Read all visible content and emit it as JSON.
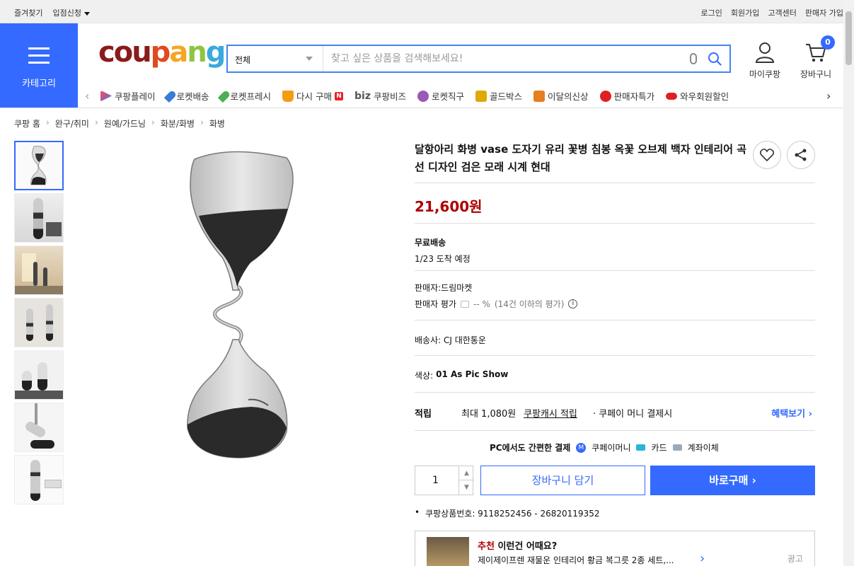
{
  "topbar": {
    "favorites": "즐겨찾기",
    "vendor_apply": "입점신청",
    "login": "로그인",
    "signup": "회원가입",
    "customer_center": "고객센터",
    "seller_signup": "판매자 가입"
  },
  "category": {
    "label": "카테고리"
  },
  "logo": {
    "part1": "cou",
    "part2": "p",
    "part3": "a",
    "part4": "n",
    "part5": "g"
  },
  "search": {
    "category_value": "전체",
    "placeholder": "찾고 싶은 상품을 검색해보세요!"
  },
  "header": {
    "my_coupang": "마이쿠팡",
    "cart": "장바구니",
    "cart_count": "0"
  },
  "nav": {
    "items": [
      {
        "label": "쿠팡플레이",
        "icon": "play-icon",
        "color": "#4a6cf7"
      },
      {
        "label": "로켓배송",
        "icon": "rocket-icon",
        "color": "#3a7bd5"
      },
      {
        "label": "로켓프레시",
        "icon": "rocket-fresh-icon",
        "color": "#4caf50"
      },
      {
        "label": "다시 구매",
        "icon": "basket-icon",
        "color": "#f39c12"
      },
      {
        "label": "쿠팡비즈",
        "icon": "biz-icon",
        "color": "#555555"
      },
      {
        "label": "로켓직구",
        "icon": "rocket-global-icon",
        "color": "#9b59b6"
      },
      {
        "label": "골드박스",
        "icon": "gift-icon",
        "color": "#e0a800"
      },
      {
        "label": "이달의신상",
        "icon": "new-bag-icon",
        "color": "#e67e22"
      },
      {
        "label": "판매자특가",
        "icon": "percent-icon",
        "color": "#e02020"
      },
      {
        "label": "와우회원할인",
        "icon": "wow-icon",
        "color": "#e02020"
      }
    ],
    "again_badge": "N",
    "biz_prefix": "biz"
  },
  "breadcrumb": [
    "쿠팡 홈",
    "완구/취미",
    "원예/가드닝",
    "화분/화병",
    "화병"
  ],
  "product": {
    "title": "달항아리 화병 vase 도자기 유리 꽃병 침봉 옥꽃 오브제 백자 인테리어 곡선 디자인 검은 모래 시계 현대",
    "price": "21,600원",
    "shipping_label": "무료배송",
    "arrival": "1/23 도착 예정",
    "seller": "판매자:드림마켓",
    "seller_rating_label": "판매자 평가",
    "seller_rating_value": "-- %",
    "seller_rating_note": "(14건 이하의 평가)",
    "carrier": "배송사:  CJ 대한통운",
    "color_label": "색상:",
    "color_value": "01 As Pic Show",
    "reward_label": "적립",
    "reward_text": "최대 1,080원",
    "reward_link": "쿠팡캐시 적립",
    "reward_suffix": "· 쿠페이 머니 결제시",
    "benefit_link": "혜택보기",
    "pay_title": "PC에서도 간편한 결제",
    "pay_methods": [
      "쿠페이머니",
      "카드",
      "계좌이체"
    ],
    "quantity": "1",
    "add_to_cart": "장바구니 담기",
    "buy_now": "바로구매",
    "product_number": "쿠팡상품번호: 9118252456 - 26820119352"
  },
  "recommend": {
    "label_red": "추천",
    "label": "이런건 어때요?",
    "item": "제이제이프렌 재물운 인테리어 황금 복그릇 2종 세트,...",
    "ad": "광고"
  },
  "colors": {
    "accent": "#346aff",
    "price": "#ae0000"
  }
}
